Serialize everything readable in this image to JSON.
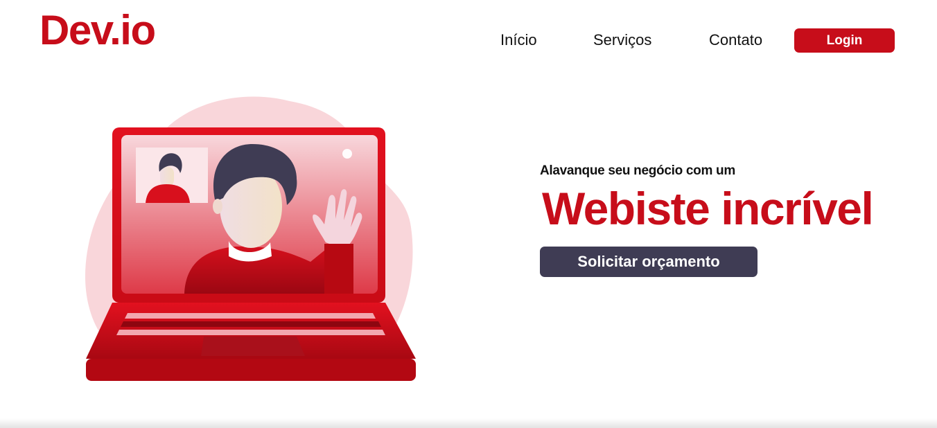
{
  "brand": {
    "logo_text": "Dev.io",
    "color": "#c70d1a"
  },
  "nav": {
    "links": [
      {
        "label": "Início"
      },
      {
        "label": "Serviços"
      },
      {
        "label": "Contato"
      }
    ],
    "login_label": "Login"
  },
  "hero": {
    "tagline": "Alavanque seu negócio com um",
    "headline": "Webiste incrível",
    "cta_label": "Solicitar orçamento",
    "cta_color": "#3f3c54",
    "illustration_icon": "laptop-video-call-illustration"
  }
}
